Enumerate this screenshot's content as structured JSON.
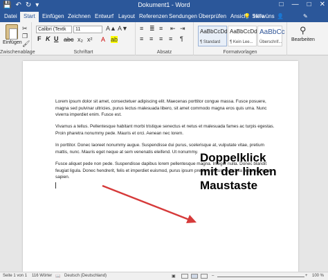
{
  "titlebar": {
    "title": "Dokument1 - Word",
    "quick_access": [
      "save-icon",
      "undo-icon",
      "redo-icon",
      "dropdown-icon"
    ],
    "controls": [
      "ribbon-display-icon",
      "minimize-icon",
      "maximize-icon",
      "close-icon"
    ]
  },
  "tabs": [
    "Datei",
    "Start",
    "Einfügen",
    "Zeichnen",
    "Entwurf",
    "Layout",
    "Referenzen",
    "Sendungen",
    "Überprüfen",
    "Ansicht",
    "Hilfe"
  ],
  "active_tab": "Start",
  "tell_me": "Sie wüns",
  "ribbon": {
    "clipboard": {
      "paste_label": "Einfügen",
      "group_label": "Zwischenablage"
    },
    "font": {
      "font_name": "Calibri (Textk",
      "font_size": "11",
      "group_label": "Schriftart"
    },
    "paragraph": {
      "group_label": "Absatz"
    },
    "styles": {
      "group_label": "Formatvorlagen",
      "items": [
        {
          "sample": "AaBbCcDd",
          "name": "¶ Standard"
        },
        {
          "sample": "AaBbCcDd",
          "name": "¶ Kein Lee..."
        },
        {
          "sample": "AaBbCc",
          "name": "Überschrif..."
        }
      ]
    },
    "editing": {
      "label": "Bearbeiten"
    }
  },
  "document": {
    "paragraphs": [
      "Lorem ipsum dolor sit amet, consectetuer adipiscing elit. Maecenas porttitor congue massa. Fusce posuere, magna sed pulvinar ultricies, purus lectus malesuada libero, sit amet commodo magna eros quis urna. Nunc viverra imperdiet enim. Fusce est.",
      "Vivamus a tellus. Pellentesque habitant morbi tristique senectus et netus et malesuada fames ac turpis egestas. Proin pharetra nonummy pede. Mauris et orci. Aenean nec lorem.",
      "In porttitor. Donec laoreet nonummy augue. Suspendisse dui purus, scelerisque at, vulputate vitae, pretium mattis, nunc. Mauris eget neque at sem venenatis eleifend. Ut nonummy.",
      "Fusce aliquet pede non pede. Suspendisse dapibus lorem pellentesque magna. Integer nulla. Donec blandit feugiat ligula. Donec hendrerit, felis et imperdiet euismod, purus ipsum pretium metus, in lacinia nulla nisl eget sapien."
    ]
  },
  "annotation": {
    "text_lines": [
      "Doppelklick",
      "mit der linken",
      "Maustaste"
    ],
    "arrow_color": "#d63a3a"
  },
  "statusbar": {
    "page": "Seite 1 von 1",
    "words": "116 Wörter",
    "language": "Deutsch (Deutschland)",
    "zoom": "100 %"
  },
  "colors": {
    "accent": "#2b579a"
  }
}
